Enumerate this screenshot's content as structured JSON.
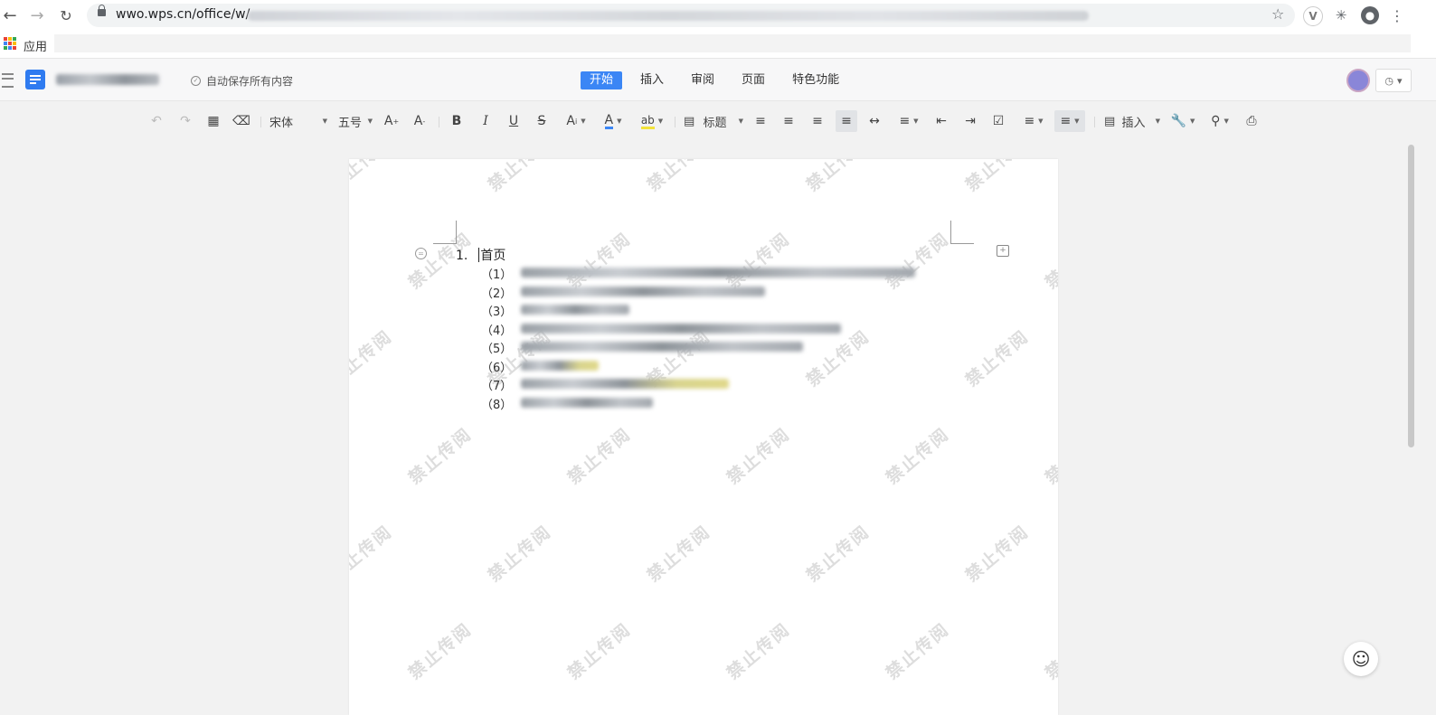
{
  "browser": {
    "url_prefix": "wwo.wps.cn/office/w/",
    "bookmarks_apps_label": "应用"
  },
  "header": {
    "autosave_text": "自动保存所有内容",
    "tabs": [
      "开始",
      "插入",
      "审阅",
      "页面",
      "特色功能"
    ],
    "active_tab": "开始"
  },
  "toolbar": {
    "font_name": "宋体",
    "font_size": "五号",
    "style_label": "标题",
    "insert_label": "插入"
  },
  "document": {
    "heading_number": "1.",
    "heading_text": "首页",
    "list_items": [
      "（1）",
      "（2）",
      "（3）",
      "（4）",
      "（5）",
      "（6）",
      "（7）",
      "（8）"
    ],
    "watermark_text": "禁止传阅"
  },
  "colors": {
    "accent": "#3b86f5",
    "doc_logo": "#2f7bf0",
    "avatar": "#8a86d8"
  }
}
